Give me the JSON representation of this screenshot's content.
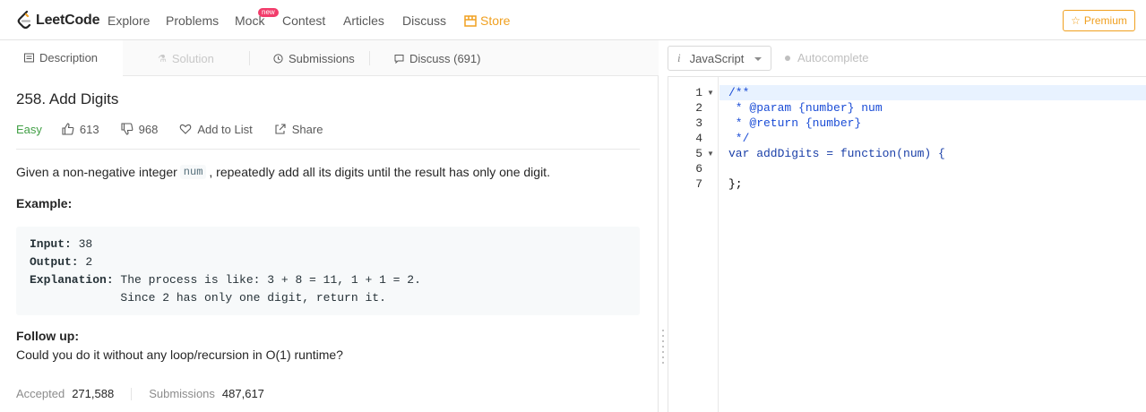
{
  "nav": {
    "logo_text": "LeetCode",
    "items": [
      "Explore",
      "Problems",
      "Mock",
      "Contest",
      "Articles",
      "Discuss"
    ],
    "mock_badge": "new",
    "store_label": "Store",
    "premium_label": "Premium"
  },
  "tabs": {
    "description": "Description",
    "solution": "Solution",
    "submissions": "Submissions",
    "discuss": "Discuss (691)"
  },
  "problem": {
    "title": "258. Add Digits",
    "difficulty": "Easy",
    "likes": "613",
    "dislikes": "968",
    "add_to_list": "Add to List",
    "share": "Share",
    "desc_before": "Given a non-negative integer",
    "desc_code": "num",
    "desc_after": ", repeatedly add all its digits until the result has only one digit.",
    "example_heading": "Example:",
    "example_lines": [
      {
        "label": "Input:",
        "text": " 38"
      },
      {
        "label": "Output:",
        "text": " 2"
      },
      {
        "label": "Explanation:",
        "text": " The process is like: 3 + 8 = 11, 1 + 1 = 2."
      },
      {
        "label": "",
        "text": "             Since 2 has only one digit, return it."
      }
    ],
    "follow_up_heading": "Follow up:",
    "follow_up_text": "Could you do it without any loop/recursion in O(1) runtime?",
    "accepted_label": "Accepted",
    "accepted_value": "271,588",
    "submissions_label": "Submissions",
    "submissions_value": "487,617"
  },
  "editor": {
    "language": "JavaScript",
    "language_icon": "i",
    "autocomplete_label": "Autocomplete",
    "line_numbers": [
      "1",
      "2",
      "3",
      "4",
      "5",
      "6",
      "7"
    ],
    "code_lines": [
      "/**",
      " * @param {number} num",
      " * @return {number}",
      " */",
      "var addDigits = function(num) {",
      "",
      "};"
    ]
  },
  "colors": {
    "accent_orange": "#f0a020",
    "easy_green": "#43a047",
    "new_badge": "#f23c6b",
    "comment_blue": "#1a4cd6"
  }
}
